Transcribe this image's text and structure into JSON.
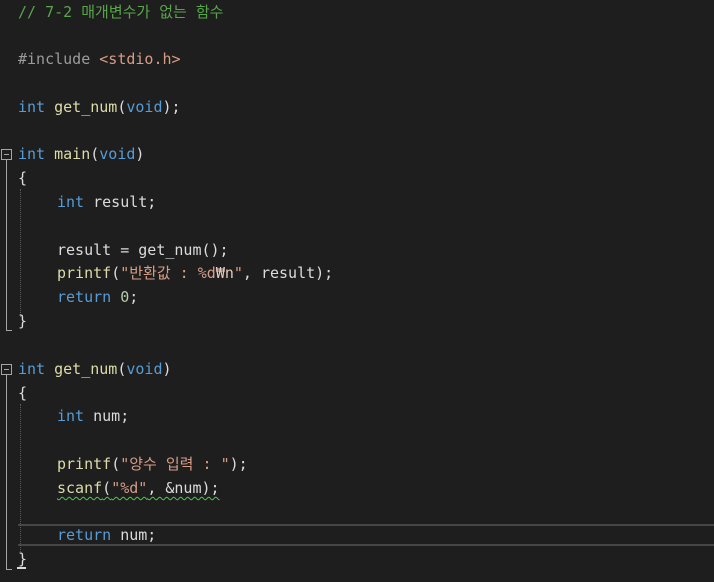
{
  "code": {
    "comment": "// 7-2 매개변수가 없는 함수",
    "include": {
      "directive": "#include",
      "path": "<stdio.h>"
    },
    "proto": {
      "type": "int",
      "name": "get_num",
      "paren_open": "(",
      "param": "void",
      "paren_close": ");"
    },
    "main": {
      "type": "int",
      "name": "main",
      "paren_open": "(",
      "param": "void",
      "paren_close": ")",
      "brace_open": "{",
      "decl_type": "int",
      "decl_name": " result;",
      "assign": "result = get_num();",
      "printf_name": "printf",
      "printf_open": "(",
      "printf_str": "\"반환값 : %d",
      "printf_escape": "₩n",
      "printf_str_end": "\"",
      "printf_rest": ", result);",
      "return_kw": "return",
      "return_val": "0",
      "return_end": ";",
      "brace_close": "}"
    },
    "get_num": {
      "type": "int",
      "name": "get_num",
      "paren_open": "(",
      "param": "void",
      "paren_close": ")",
      "brace_open": "{",
      "decl_type": "int",
      "decl_name": " num;",
      "printf_name": "printf",
      "printf_open": "(",
      "printf_str": "\"양수 입력 : \"",
      "printf_end": ");",
      "scanf_name": "scanf",
      "scanf_open": "(",
      "scanf_str": "\"%d\"",
      "scanf_rest": ", &num);",
      "return_kw": "return",
      "return_rest": " num;",
      "brace_close": "}"
    }
  },
  "colors": {
    "background": "#1e1e1e",
    "comment": "#57a64a",
    "keyword": "#569cd6",
    "function": "#dcdcaa",
    "string": "#d69d85",
    "number": "#b5cea8",
    "text": "#dcdcdc"
  }
}
